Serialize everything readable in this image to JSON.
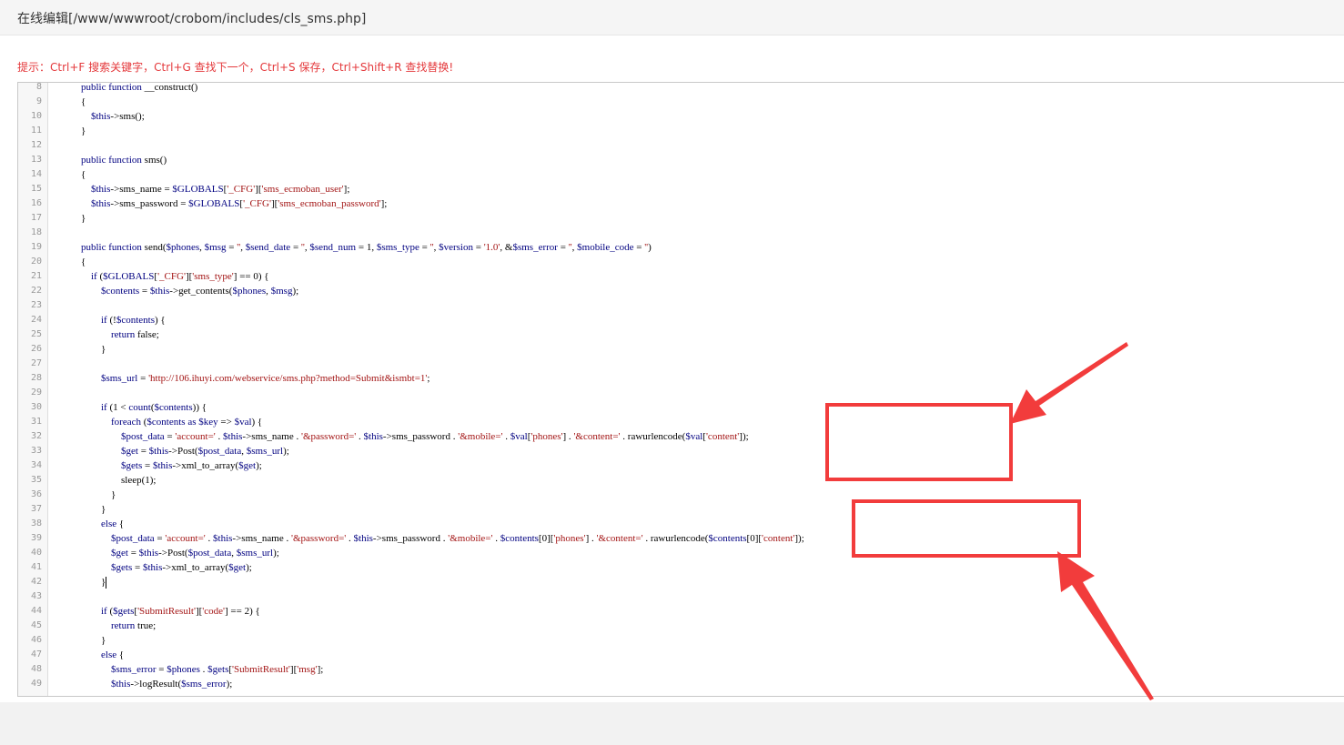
{
  "page": {
    "title": "在线编辑[/www/wwwroot/crobom/includes/cls_sms.php]",
    "hint": "提示：Ctrl+F 搜索关键字，Ctrl+G 查找下一个，Ctrl+S 保存，Ctrl+Shift+R 查找替换!"
  },
  "colors": {
    "accent": "#f23c3c",
    "hint": "#e4393c",
    "keyword": "#000080",
    "string": "#a31515"
  },
  "editor": {
    "lines": [
      {
        "n": "8",
        "code": "    public function __construct()"
      },
      {
        "n": "9",
        "code": "    {"
      },
      {
        "n": "10",
        "code": "        $this->sms();"
      },
      {
        "n": "11",
        "code": "    }"
      },
      {
        "n": "12",
        "code": ""
      },
      {
        "n": "13",
        "code": "    public function sms()"
      },
      {
        "n": "14",
        "code": "    {"
      },
      {
        "n": "15",
        "code": "        $this->sms_name = $GLOBALS['_CFG']['sms_ecmoban_user'];"
      },
      {
        "n": "16",
        "code": "        $this->sms_password = $GLOBALS['_CFG']['sms_ecmoban_password'];"
      },
      {
        "n": "17",
        "code": "    }"
      },
      {
        "n": "18",
        "code": ""
      },
      {
        "n": "19",
        "code": "    public function send($phones, $msg = '', $send_date = '', $send_num = 1, $sms_type = '', $version = '1.0', &$sms_error = '', $mobile_code = '')"
      },
      {
        "n": "20",
        "code": "    {"
      },
      {
        "n": "21",
        "code": "        if ($GLOBALS['_CFG']['sms_type'] == 0) {"
      },
      {
        "n": "22",
        "code": "            $contents = $this->get_contents($phones, $msg);"
      },
      {
        "n": "23",
        "code": ""
      },
      {
        "n": "24",
        "code": "            if (!$contents) {"
      },
      {
        "n": "25",
        "code": "                return false;"
      },
      {
        "n": "26",
        "code": "            }"
      },
      {
        "n": "27",
        "code": ""
      },
      {
        "n": "28",
        "code": "            $sms_url = 'http://106.ihuyi.com/webservice/sms.php?method=Submit&ismbt=1';"
      },
      {
        "n": "29",
        "code": ""
      },
      {
        "n": "30",
        "code": "            if (1 < count($contents)) {"
      },
      {
        "n": "31",
        "code": "                foreach ($contents as $key => $val) {"
      },
      {
        "n": "32",
        "code": "                    $post_data = 'account=' . $this->sms_name . '&password=' . $this->sms_password . '&mobile=' . $val['phones'] . '&content=' . rawurlencode($val['content']);"
      },
      {
        "n": "33",
        "code": "                    $get = $this->Post($post_data, $sms_url);"
      },
      {
        "n": "34",
        "code": "                    $gets = $this->xml_to_array($get);"
      },
      {
        "n": "35",
        "code": "                    sleep(1);"
      },
      {
        "n": "36",
        "code": "                }"
      },
      {
        "n": "37",
        "code": "            }"
      },
      {
        "n": "38",
        "code": "            else {"
      },
      {
        "n": "39",
        "code": "                $post_data = 'account=' . $this->sms_name . '&password=' . $this->sms_password . '&mobile=' . $contents[0]['phones'] . '&content=' . rawurlencode($contents[0]['content']);"
      },
      {
        "n": "40",
        "code": "                $get = $this->Post($post_data, $sms_url);"
      },
      {
        "n": "41",
        "code": "                $gets = $this->xml_to_array($get);"
      },
      {
        "n": "42",
        "code": "            }"
      },
      {
        "n": "43",
        "code": ""
      },
      {
        "n": "44",
        "code": "            if ($gets['SubmitResult']['code'] == 2) {"
      },
      {
        "n": "45",
        "code": "                return true;"
      },
      {
        "n": "46",
        "code": "            }"
      },
      {
        "n": "47",
        "code": "            else {"
      },
      {
        "n": "48",
        "code": "                $sms_error = $phones . $gets['SubmitResult']['msg'];"
      },
      {
        "n": "49",
        "code": "                $this->logResult($sms_error);"
      }
    ]
  }
}
